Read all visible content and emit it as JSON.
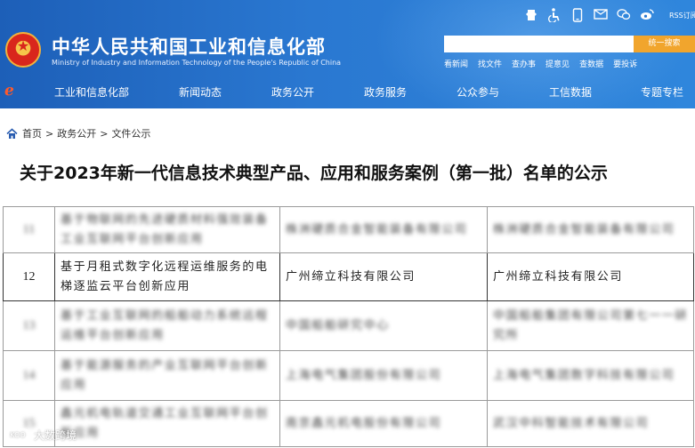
{
  "header": {
    "ministry_name": "中华人民共和国工业和信息化部",
    "ministry_en": "Ministry of Industry and Information Technology of the People's Republic of China",
    "rss_label": "RSS订阅",
    "icons": [
      "app-icon",
      "accessibility-icon",
      "mobile-icon",
      "mail-icon",
      "wechat-icon",
      "weibo-icon"
    ],
    "search_placeholder": "",
    "search_button": "统一搜索",
    "quick_links": [
      "看新闻",
      "找文件",
      "查办事",
      "提意见",
      "查数据",
      "要投诉"
    ],
    "nav_items": [
      "工业和信息化部",
      "新闻动态",
      "政务公开",
      "政务服务",
      "公众参与",
      "工信数据",
      "专题专栏"
    ]
  },
  "breadcrumb": {
    "items": [
      "首页",
      "政务公开",
      "文件公示"
    ],
    "separator": ">"
  },
  "title": "关于2023年新一代信息技术典型产品、应用和服务案例（第一批）名单的公示",
  "table": {
    "rows": [
      {
        "num": "11",
        "project": "基于物联网的先进硬质材料强效装备工业互联网平台创新应用",
        "applicant": "株洲硬质合金智能装备有限公司",
        "supplier": "株洲硬质合金智能装备有限公司",
        "blurred": true
      },
      {
        "num": "12",
        "project": "基于月租式数字化远程运维服务的电梯逐监云平台创新应用",
        "applicant": "广州缔立科技有限公司",
        "supplier": "广州缔立科技有限公司",
        "blurred": false
      },
      {
        "num": "13",
        "project": "基于工业互联网的船舶动力系统远程运维平台创新应用",
        "applicant": "中国船舶研究中心",
        "supplier": "中国船舶集团有限公司第七一一研究所",
        "blurred": true
      },
      {
        "num": "14",
        "project": "基于能源服务的产业互联网平台创新应用",
        "applicant": "上海电气集团股份有限公司",
        "supplier": "上海电气集团数字科技有限公司",
        "blurred": true
      },
      {
        "num": "15",
        "project": "鑫元机电轨道交通工业互联网平台创新应用",
        "applicant": "南京鑫元机电股份有限公司",
        "supplier": "武汉中科智能技术有限公司",
        "blurred": true
      }
    ]
  },
  "watermark": {
    "logo": "KOO",
    "text": "大数跨境"
  },
  "colors": {
    "header_blue": "#2a78d1",
    "search_button": "#f1a52d",
    "accent_red": "#d9261c"
  }
}
